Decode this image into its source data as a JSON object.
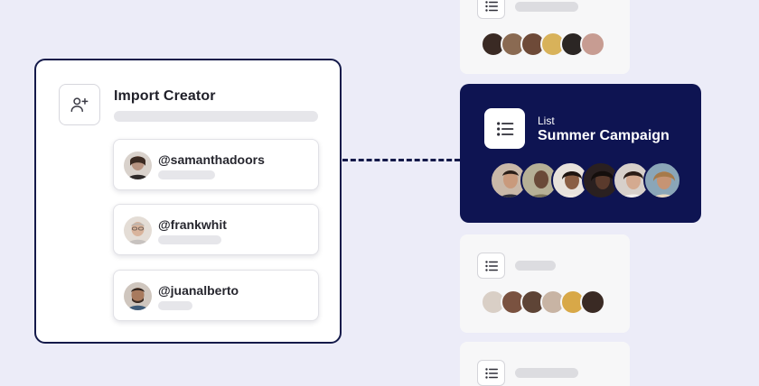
{
  "import_card": {
    "title": "Import Creator",
    "icon": "add-user-icon",
    "creators": [
      {
        "handle": "@samanthadoors",
        "avatar_color": "#a78b7a"
      },
      {
        "handle": "@frankwhit",
        "avatar_color": "#c9b7a6"
      },
      {
        "handle": "@juanalberto",
        "avatar_color": "#7a5a46"
      }
    ]
  },
  "featured_list": {
    "kicker": "List",
    "title": "Summer Campaign",
    "icon": "list-icon",
    "background": "#0e1452"
  },
  "colors": {
    "accent_navy": "#0e1452",
    "page_bg": "#ececf8",
    "connector": "#141a4a"
  }
}
